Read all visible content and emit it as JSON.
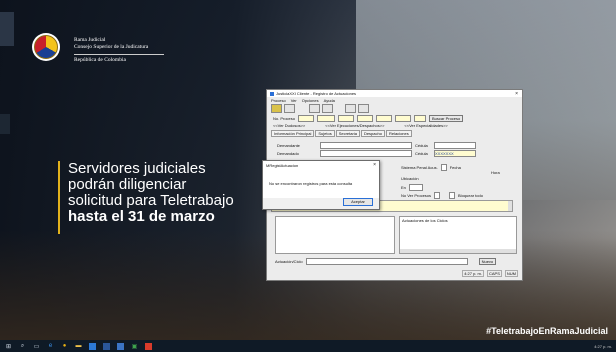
{
  "brand": {
    "line1": "Rama Judicial",
    "line2": "Consejo Superior de la Judicatura",
    "line3": "República de Colombia"
  },
  "headline": {
    "line1": "Servidores judiciales",
    "line2": "podrán diligenciar",
    "line3": "solicitud para Teletrabajo",
    "line4": "hasta el 31 de marzo"
  },
  "hashtag": "#TeletrabajoEnRamaJudicial",
  "app": {
    "title": "JusticiaXXI Cliente - Registro de Actuaciones",
    "menu": [
      "Proceso",
      "Ver",
      "Opciones",
      "Ayuda"
    ],
    "no_proceso_label": "No. Proceso",
    "buscar_proceso": "Buscar Proceso",
    "ver_dudas": "<<Ver Dudosos>>",
    "ver_ejecuciones": "<<Ver Ejecuciones/Despachos>>",
    "ver_especialidades": "<<Ver Especialidades>>",
    "tabs": [
      "Información Principal",
      "Sujetos",
      "Secretaria",
      "Despacho",
      "Relaciones"
    ],
    "demandante": "Demandante",
    "demandado": "Demandado",
    "cedula": "Cédula",
    "cedula_value": "XXXXXXX",
    "sistema_penal": "Sistema Penal Acus.",
    "fecha": "Fecha",
    "hora": "Hora",
    "ubicacion": "Ubicación",
    "en": "En",
    "no_ver_procesos": "No Ver Procesos",
    "bloquear_todo": "Bloquear todo",
    "actuacion_previa": "Actuación Previa",
    "actuaciones_ciclo": "Actuaciones de los Ciclos",
    "actuacion_ciclo": "Actuación/Ciclo",
    "nuevo": "Nuevo",
    "status": [
      "4:27 p. m.",
      "CAPS",
      "NUM"
    ]
  },
  "dialog": {
    "title": "MRegistActuacion",
    "message": "No se encontraron registros para esta consulta",
    "ok": "Aceptar",
    "close": "×"
  },
  "taskbar": {
    "tray": "4:27 p. m."
  }
}
